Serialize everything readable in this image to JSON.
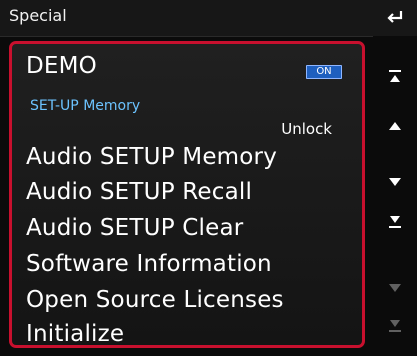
{
  "header": {
    "title": "Special",
    "back_icon": "back-arrow-icon"
  },
  "list": {
    "demo": {
      "label": "DEMO",
      "state": "ON"
    },
    "setup_memory": {
      "section_label": "SET-UP Memory",
      "action": "Unlock"
    },
    "items": [
      {
        "label": "Audio SETUP Memory"
      },
      {
        "label": "Audio SETUP Recall"
      },
      {
        "label": "Audio SETUP Clear"
      },
      {
        "label": "Software Information"
      },
      {
        "label": "Open Source Licenses"
      },
      {
        "label": "Initialize"
      }
    ]
  },
  "scrollbar": {
    "buttons": [
      {
        "icon": "page-top-icon",
        "enabled": true
      },
      {
        "icon": "scroll-up-icon",
        "enabled": true
      },
      {
        "icon": "scroll-down-icon",
        "enabled": true
      },
      {
        "icon": "page-bottom-icon",
        "enabled": true
      },
      {
        "icon": "scroll-down-dim-icon",
        "enabled": false
      },
      {
        "icon": "page-bottom-dim-icon",
        "enabled": false
      }
    ]
  },
  "colors": {
    "accent_border": "#c8102e",
    "section_text": "#6cc3ff",
    "badge_bg": "#1e5fbf"
  }
}
